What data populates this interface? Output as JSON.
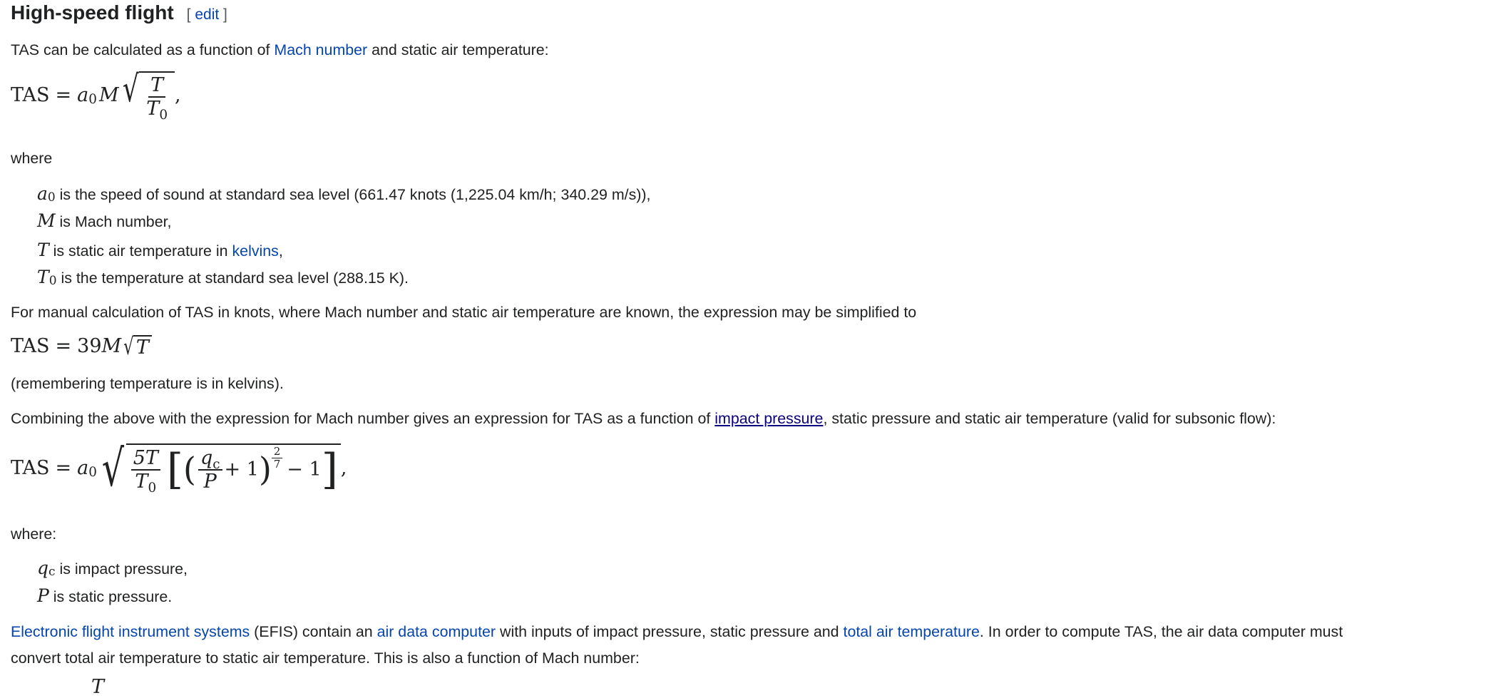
{
  "heading": {
    "title": "High-speed flight",
    "edit_open": "[",
    "edit_label": "edit",
    "edit_close": "]"
  },
  "p1": {
    "pre": "TAS can be calculated as a function of ",
    "link": "Mach number",
    "post": " and static air temperature:"
  },
  "math": {
    "tas": "TAS",
    "eq": "=",
    "a0": "a",
    "zero": "0",
    "M": "M",
    "T": "T",
    "comma": ",",
    "n39": "39",
    "fiveT": "5T",
    "qc_q": "q",
    "qc_c": "c",
    "P": "P",
    "plus1": "+ 1",
    "minus1": "− 1",
    "exp_num": "2",
    "exp_den": "7"
  },
  "where1": "where",
  "defs1": [
    {
      "sym": "a",
      "sub": "0",
      "text": " is the speed of sound at standard sea level (661.47 knots (1,225.04 km/h; 340.29 m/s)),"
    },
    {
      "sym": "M",
      "text": " is Mach number,"
    },
    {
      "sym": "T",
      "pre": " is static air temperature in ",
      "link": "kelvins",
      "post": ","
    },
    {
      "sym": "T",
      "sub": "0",
      "text": " is the temperature at standard sea level (288.15 K)."
    }
  ],
  "p2": "For manual calculation of TAS in knots, where Mach number and static air temperature are known, the expression may be simplified to",
  "p3": "(remembering temperature is in kelvins).",
  "p4": {
    "pre": "Combining the above with the expression for Mach number gives an expression for TAS as a function of ",
    "link": "impact pressure",
    "post": ", static pressure and static air temperature (valid for subsonic flow):"
  },
  "where2": "where:",
  "defs2": [
    {
      "sym": "q",
      "sub": "c",
      "text": " is impact pressure,"
    },
    {
      "sym": "P",
      "text": " is static pressure."
    }
  ],
  "p5": {
    "link1": "Electronic flight instrument systems",
    "t1": " (EFIS) contain an ",
    "link2": "air data computer",
    "t2": " with inputs of impact pressure, static pressure and ",
    "link3": "total air temperature",
    "t3": ". In order to compute TAS, the air data computer must",
    "line2": "convert total air temperature to static air temperature. This is also a function of Mach number:"
  }
}
